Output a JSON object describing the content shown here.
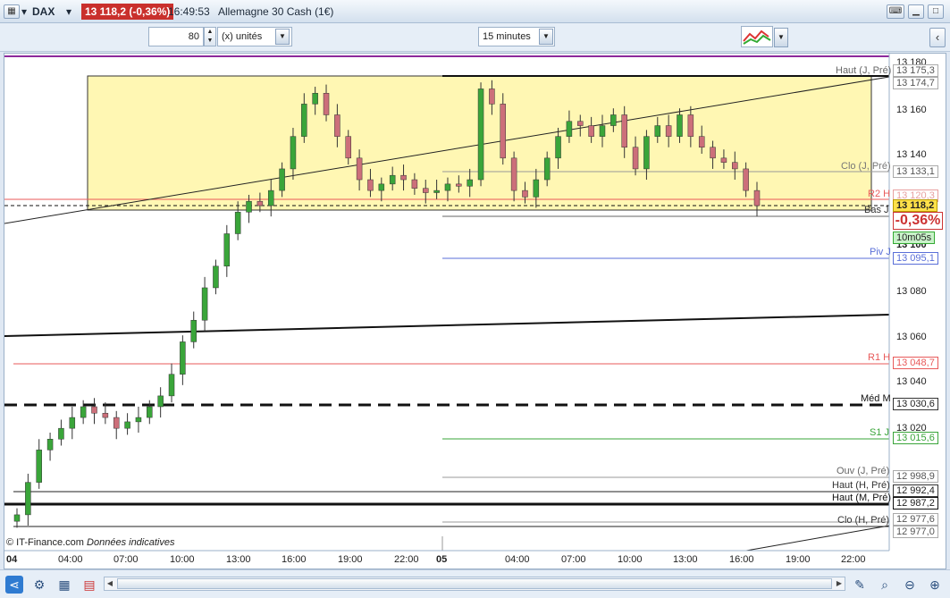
{
  "window": {
    "symbol": "DAX",
    "price_badge": "13 118,2 (-0,36%)",
    "time": "16:49:53",
    "instrument": "Allemagne 30 Cash (1€)"
  },
  "toolbar": {
    "units_value": "80",
    "units_label": "(x) unités",
    "period_label": "15 minutes"
  },
  "chart": {
    "credit": "© IT-Finance.com",
    "credit_note": "Données indicatives",
    "y_ticks": [
      "13 180",
      "13 160",
      "13 140",
      "13 100",
      "13 080",
      "13 060",
      "13 040",
      "13 020"
    ],
    "x_ticks": [
      "04",
      "04:00",
      "07:00",
      "10:00",
      "13:00",
      "16:00",
      "19:00",
      "22:00",
      "05",
      "04:00",
      "07:00",
      "10:00",
      "13:00",
      "16:00",
      "19:00",
      "22:00"
    ],
    "levels": [
      {
        "label": "Haut (J, Pré)",
        "value": "13 175,3"
      },
      {
        "label": "",
        "value": "13 174,7"
      },
      {
        "label": "Clo (J, Pré)",
        "value": "13 133,1"
      },
      {
        "label": "R2 H",
        "value": "13 120,3"
      },
      {
        "label": "Bas J",
        "value": "13 118,2"
      },
      {
        "label": "Piv J",
        "value": "13 095,1"
      },
      {
        "label": "R1 H",
        "value": "13 048,7"
      },
      {
        "label": "Méd M",
        "value": "13 030,6"
      },
      {
        "label": "S1 J",
        "value": "13 015,6"
      },
      {
        "label": "Ouv (J, Pré)",
        "value": "12 998,9"
      },
      {
        "label": "Haut (H, Pré)",
        "value": "12 992,4"
      },
      {
        "label": "Haut (M, Pré)",
        "value": "12 987,2"
      },
      {
        "label": "Clo (H, Pré)",
        "value": "12 977,6"
      },
      {
        "label": "",
        "value": "12 977,0"
      }
    ],
    "change_pct": "-0,36%",
    "countdown": "10m05s",
    "colors": {
      "up": "#3aa53a",
      "down": "#cc6f7a",
      "box": "#fff7b3",
      "red_line": "#e85a5a",
      "blue_line": "#5a6fd8",
      "green_line": "#3aa53a"
    }
  },
  "chart_data": {
    "type": "candlestick",
    "ylim": [
      12970,
      13185
    ],
    "close_series": [
      12975,
      12990,
      13005,
      13010,
      13015,
      13020,
      13025,
      13022,
      13020,
      13015,
      13018,
      13020,
      13025,
      13030,
      13040,
      13055,
      13065,
      13080,
      13090,
      13105,
      13115,
      13120,
      13118,
      13125,
      13135,
      13150,
      13165,
      13170,
      13160,
      13150,
      13140,
      13130,
      13125,
      13128,
      13132,
      13130,
      13126,
      13124,
      13125,
      13128,
      13127,
      13130,
      13172,
      13165,
      13140,
      13125,
      13122,
      13130,
      13140,
      13150,
      13157,
      13155,
      13150,
      13155,
      13160,
      13145,
      13135,
      13150,
      13155,
      13150,
      13160,
      13150,
      13145,
      13140,
      13138,
      13135,
      13125,
      13118
    ]
  }
}
